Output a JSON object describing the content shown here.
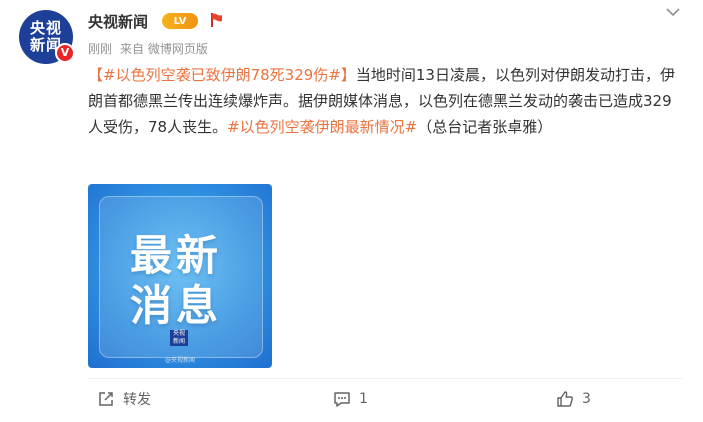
{
  "post": {
    "author": {
      "name": "央视新闻",
      "avatar_line1": "央视",
      "avatar_line2": "新闻",
      "verified_badge": "V",
      "level_badge": "LV"
    },
    "meta": {
      "time": "刚刚",
      "source": "来自 微博网页版"
    },
    "content": {
      "tag1": "【#以色列空袭已致伊朗78死329伤#】",
      "text1": "当地时间13日凌晨，以色列对伊朗发动打击，伊朗首都德黑兰传出连续爆炸声。据伊朗媒体消息，以色列在德黑兰发动的袭击已造成329人受伤，78人丧生。",
      "tag2": "#以色列空袭伊朗最新情况#",
      "text2": "（总台记者张卓雅）"
    },
    "image": {
      "line1": "最新",
      "line2": "消息",
      "logo_line1": "央视",
      "logo_line2": "新闻",
      "watermark": "@央视新闻"
    },
    "actions": {
      "repost_label": "转发",
      "comment_count": "1",
      "like_count": "3"
    }
  },
  "colors": {
    "tag": "#eb7340",
    "avatar_bg": "#1d3f97",
    "level_badge": "#f4a517",
    "verified": "#e8252b"
  },
  "icons": [
    "flag-icon",
    "chevron-down-icon",
    "repost-icon",
    "comment-icon",
    "like-icon"
  ]
}
